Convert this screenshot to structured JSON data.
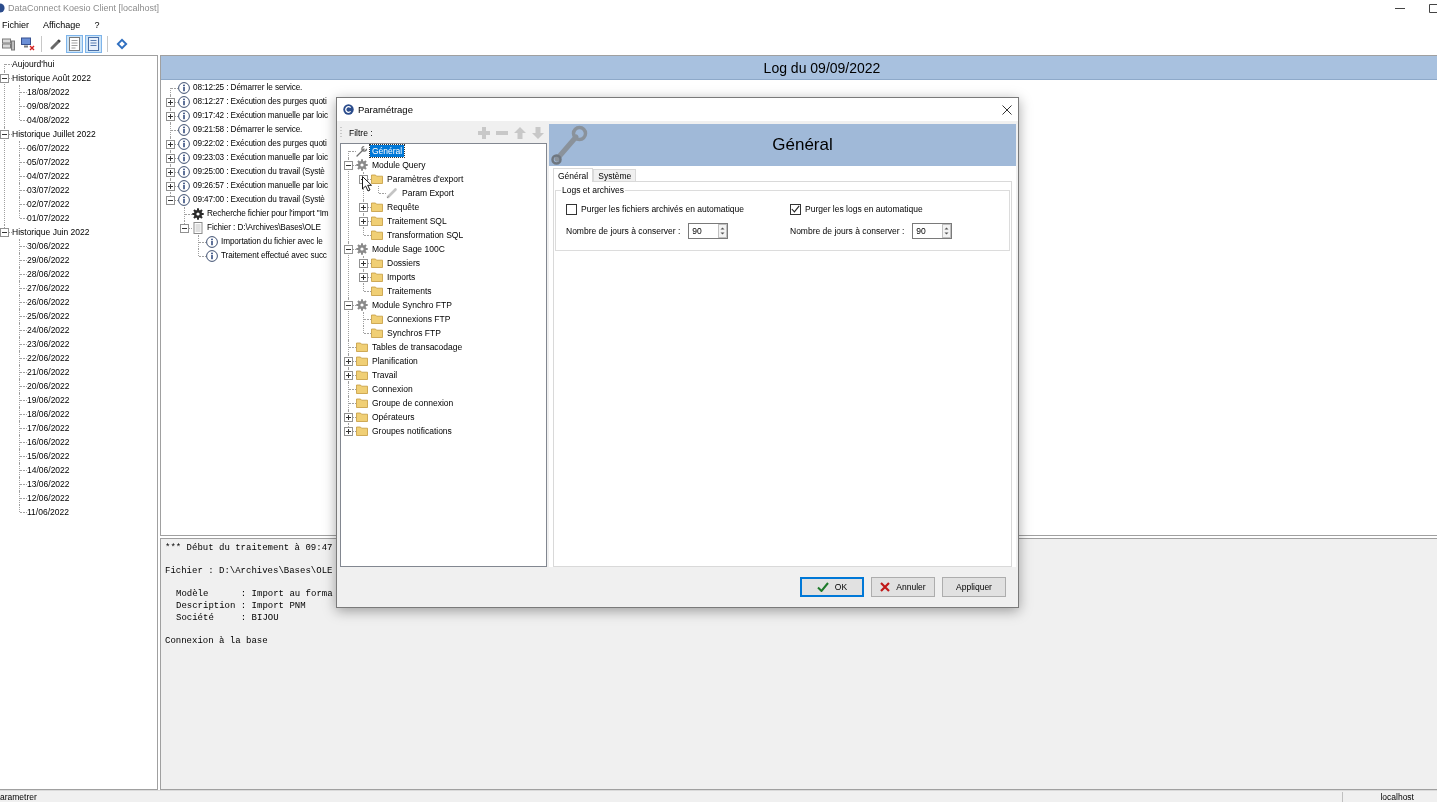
{
  "window": {
    "title": "DataConnect Koesio Client [localhost]"
  },
  "menu": [
    {
      "label": "Fichier"
    },
    {
      "label": "Affichage"
    },
    {
      "label": "?"
    }
  ],
  "toolbar": [
    {
      "kind": "servers",
      "pressed": false
    },
    {
      "kind": "network",
      "pressed": false
    },
    {
      "kind": "separator"
    },
    {
      "kind": "brush",
      "pressed": false
    },
    {
      "kind": "document",
      "pressed": true
    },
    {
      "kind": "log",
      "pressed": true
    },
    {
      "kind": "separator"
    },
    {
      "kind": "diamond",
      "pressed": false
    }
  ],
  "history_tree": [
    {
      "label": "Aujourd'hui"
    },
    {
      "label": "Historique Août 2022",
      "expanded": true,
      "children": [
        {
          "label": "18/08/2022"
        },
        {
          "label": "09/08/2022"
        },
        {
          "label": "04/08/2022"
        }
      ]
    },
    {
      "label": "Historique Juillet 2022",
      "expanded": true,
      "children": [
        {
          "label": "06/07/2022"
        },
        {
          "label": "05/07/2022"
        },
        {
          "label": "04/07/2022"
        },
        {
          "label": "03/07/2022"
        },
        {
          "label": "02/07/2022"
        },
        {
          "label": "01/07/2022"
        }
      ]
    },
    {
      "label": "Historique Juin 2022",
      "expanded": true,
      "children": [
        {
          "label": "30/06/2022"
        },
        {
          "label": "29/06/2022"
        },
        {
          "label": "28/06/2022"
        },
        {
          "label": "27/06/2022"
        },
        {
          "label": "26/06/2022"
        },
        {
          "label": "25/06/2022"
        },
        {
          "label": "24/06/2022"
        },
        {
          "label": "23/06/2022"
        },
        {
          "label": "22/06/2022"
        },
        {
          "label": "21/06/2022"
        },
        {
          "label": "20/06/2022"
        },
        {
          "label": "19/06/2022"
        },
        {
          "label": "18/06/2022"
        },
        {
          "label": "17/06/2022"
        },
        {
          "label": "16/06/2022"
        },
        {
          "label": "15/06/2022"
        },
        {
          "label": "14/06/2022"
        },
        {
          "label": "13/06/2022"
        },
        {
          "label": "12/06/2022"
        },
        {
          "label": "11/06/2022"
        }
      ]
    }
  ],
  "log": {
    "title": "Log du 09/09/2022",
    "entries": [
      {
        "kind": "info",
        "text": "08:12:25 : Démarrer le service."
      },
      {
        "kind": "info",
        "text": "08:12:27 : Exécution des purges quoti",
        "expanded": false
      },
      {
        "kind": "info",
        "text": "09:17:42 : Exécution manuelle par loic",
        "expanded": false
      },
      {
        "kind": "info",
        "text": "09:21:58 : Démarrer le service."
      },
      {
        "kind": "info",
        "text": "09:22:02 : Exécution des purges quoti",
        "expanded": false
      },
      {
        "kind": "info",
        "text": "09:23:03 : Exécution manuelle par loic",
        "expanded": false
      },
      {
        "kind": "info",
        "text": "09:25:00 : Execution du travail (Systè",
        "expanded": false
      },
      {
        "kind": "info",
        "text": "09:26:57 : Exécution manuelle par loic",
        "expanded": false
      },
      {
        "kind": "info",
        "text": "09:47:00 : Execution du travail (Systè",
        "expanded": true,
        "children": [
          {
            "kind": "task",
            "text": "Recherche fichier pour l'import \"Im"
          },
          {
            "kind": "file",
            "text": "Fichier : D:\\Archives\\Bases\\OLE",
            "expanded": true,
            "children": [
              {
                "kind": "info",
                "text": "Importation du fichier avec le"
              },
              {
                "kind": "info",
                "text": "Traitement effectué avec succ"
              }
            ]
          }
        ]
      }
    ]
  },
  "output": {
    "blocks": [
      {
        "kind": "line",
        "lines": [
          "*** Début du traitement à 09:47"
        ]
      },
      {
        "kind": "line",
        "lines": [
          "Fichier : D:\\Archives\\Bases\\OLE"
        ]
      },
      {
        "kind": "details",
        "lines": [
          "Modèle      : Import au forma",
          "Description : Import PNM",
          "Société     : BIJOU"
        ]
      },
      {
        "kind": "line",
        "lines": [
          "Connexion à la base"
        ]
      }
    ]
  },
  "dialog": {
    "title": "Paramétrage",
    "filter_label": "Filtre :",
    "tree_tools": [
      {
        "kind": "add",
        "disabled": true
      },
      {
        "kind": "remove",
        "disabled": true
      },
      {
        "kind": "up",
        "disabled": true
      },
      {
        "kind": "down",
        "disabled": true
      }
    ],
    "tree": [
      {
        "kind": "setting",
        "label": "Général",
        "selected": true
      },
      {
        "kind": "module",
        "label": "Module Query",
        "selected": false,
        "expanded": true,
        "children": [
          {
            "kind": "folder",
            "label": "Paramètres d'export",
            "selected": false,
            "expanded": true,
            "children": [
              {
                "kind": "param",
                "label": "Param Export",
                "selected": false
              }
            ]
          },
          {
            "kind": "folder",
            "label": "Requête",
            "selected": false,
            "expanded": false
          },
          {
            "kind": "folder",
            "label": "Traitement SQL",
            "selected": false,
            "expanded": false
          },
          {
            "kind": "folder",
            "label": "Transformation SQL",
            "selected": false
          }
        ]
      },
      {
        "kind": "module",
        "label": "Module Sage 100C",
        "selected": false,
        "expanded": true,
        "children": [
          {
            "kind": "folder",
            "label": "Dossiers",
            "selected": false,
            "expanded": false
          },
          {
            "kind": "folder",
            "label": "Imports",
            "selected": false,
            "expanded": false
          },
          {
            "kind": "folder",
            "label": "Traitements",
            "selected": false
          }
        ]
      },
      {
        "kind": "module",
        "label": "Module Synchro FTP",
        "selected": false,
        "expanded": true,
        "children": [
          {
            "kind": "folder",
            "label": "Connexions FTP",
            "selected": false
          },
          {
            "kind": "folder",
            "label": "Synchros FTP",
            "selected": false
          }
        ]
      },
      {
        "kind": "folder",
        "label": "Tables de transacodage",
        "selected": false
      },
      {
        "kind": "folder",
        "label": "Planification",
        "selected": false,
        "expanded": false
      },
      {
        "kind": "folder",
        "label": "Travail",
        "selected": false,
        "expanded": false
      },
      {
        "kind": "folder",
        "label": "Connexion",
        "selected": false
      },
      {
        "kind": "folder",
        "label": "Groupe de connexion",
        "selected": false
      },
      {
        "kind": "folder",
        "label": "Opérateurs",
        "selected": false,
        "expanded": false
      },
      {
        "kind": "folder",
        "label": "Groupes notifications",
        "selected": false,
        "expanded": false
      }
    ],
    "header": "Général",
    "tabs": [
      {
        "label": "Général",
        "selected": true
      },
      {
        "label": "Système",
        "selected": false
      }
    ],
    "group": {
      "title": "Logs et archives",
      "options": [
        {
          "label": "Purger les fichiers archivés en automatique",
          "checked": false,
          "days_label": "Nombre de jours à conserver :",
          "days": "90"
        },
        {
          "label": "Purger les logs en automatique",
          "checked": true,
          "days_label": "Nombre de jours à conserver :",
          "days": "90"
        }
      ]
    },
    "buttons": [
      {
        "kind": "ok",
        "label": "OK",
        "default": true
      },
      {
        "kind": "cancel",
        "label": "Annuler",
        "default": false
      },
      {
        "kind": "apply",
        "label": "Appliquer",
        "default": false
      }
    ]
  },
  "status_bar": {
    "left": "arametrer",
    "right": "localhost"
  }
}
